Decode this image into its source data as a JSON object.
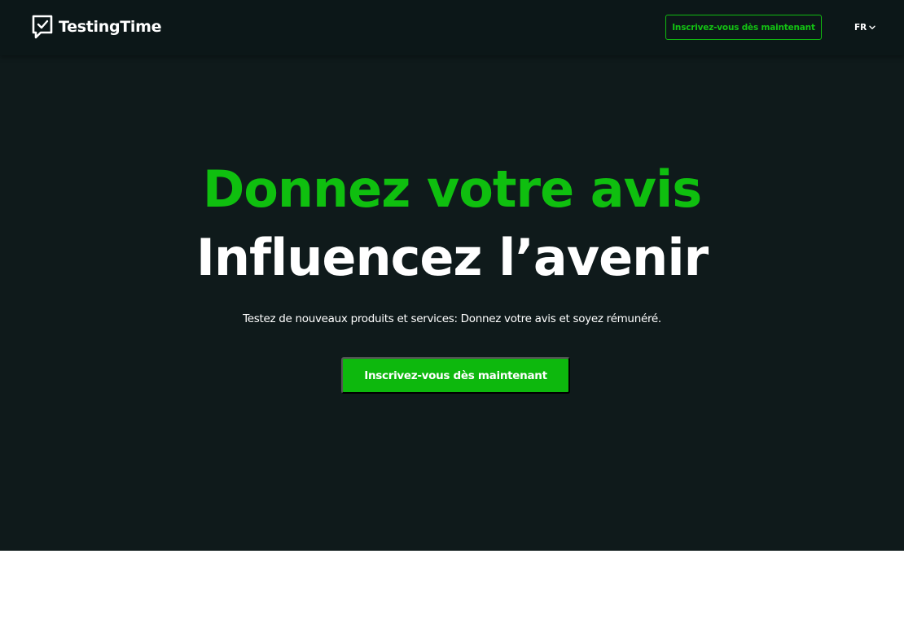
{
  "brand": {
    "name": "TestingTime",
    "logo_icon": "chat-bubble-checkmark-icon"
  },
  "navbar": {
    "cta_label": "Inscrivez-vous dès maintenant",
    "language": "FR",
    "language_icon": "chevron-down-icon"
  },
  "hero": {
    "headline_primary": "Donnez votre avis",
    "headline_secondary": "Influencez l’avenir",
    "subtitle": "Testez de nouveaux produits et services: Donnez votre avis et soyez rémunéré.",
    "cta_label": "Inscrivez-vous dès maintenant"
  },
  "colors": {
    "hero_background": "#0f1a1b",
    "navbar_background": "#0c1718",
    "accent_green": "#0fbf0f",
    "text_white": "#ffffff",
    "page_background": "#ffffff"
  }
}
